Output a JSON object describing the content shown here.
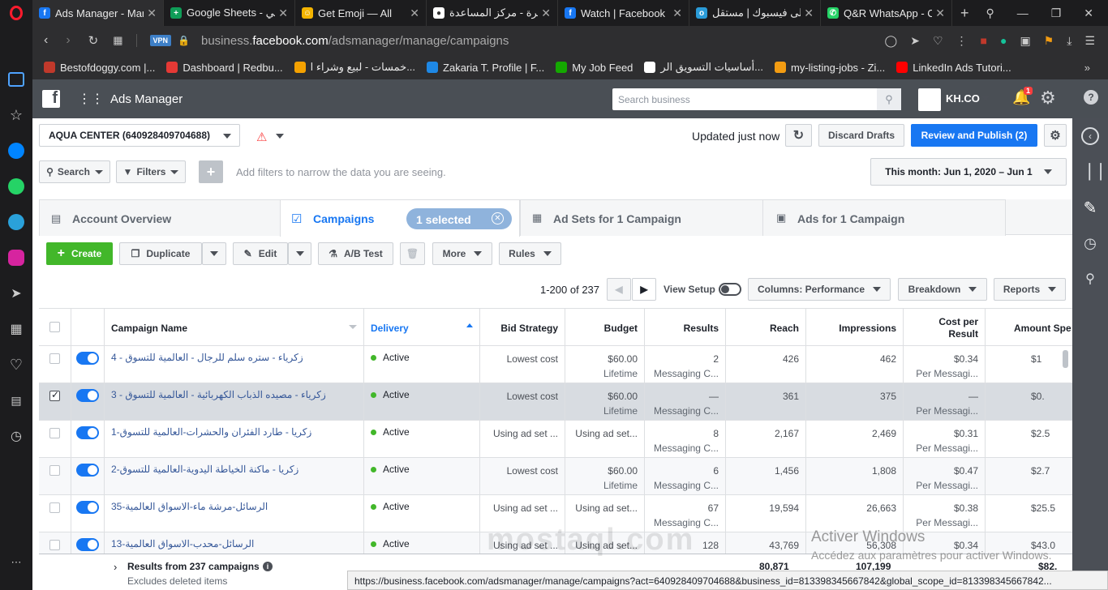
{
  "browser": {
    "tabs": [
      {
        "title": "Ads Manager - Man",
        "color": "#1877f2",
        "glyph": "f",
        "active": true
      },
      {
        "title": "Google Sheets - الي",
        "color": "#0f9d58",
        "glyph": "+"
      },
      {
        "title": "Get Emoji — All",
        "color": "#f4b400",
        "glyph": "☺"
      },
      {
        "title": "ذكرة - مركز المساعدة",
        "color": "#ffffff",
        "glyph": "●"
      },
      {
        "title": "Watch | Facebook",
        "color": "#1877f2",
        "glyph": "f"
      },
      {
        "title": "لى فيسبوك | مستقل",
        "color": "#2a9bd8",
        "glyph": "o"
      },
      {
        "title": "Q&R WhatsApp - C",
        "color": "#25d366",
        "glyph": "✆"
      }
    ],
    "url_prefix": "business.",
    "url_domain": "facebook.com",
    "url_path": "/adsmanager/manage/campaigns",
    "vpn_label": "VPN",
    "bookmarks": [
      {
        "label": "Bestofdoggy.com |...",
        "color": "#c0392b"
      },
      {
        "label": "Dashboard | Redbu...",
        "color": "#e53935"
      },
      {
        "label": "خمسات - لبيع وشراء ا...",
        "color": "#f4a100"
      },
      {
        "label": "Zakaria T. Profile | F...",
        "color": "#1e88e5"
      },
      {
        "label": "My Job Feed",
        "color": "#14a800"
      },
      {
        "label": "أساسيات التسويق الر...",
        "color": "#ffffff"
      },
      {
        "label": "my-listing-jobs - Zi...",
        "color": "#f39c12"
      },
      {
        "label": "LinkedIn Ads Tutori...",
        "color": "#ff0000"
      }
    ]
  },
  "header": {
    "app_name": "Ads Manager",
    "search_placeholder": "Search business",
    "account_short": "KH.CO",
    "notif_count": "1"
  },
  "toolbar": {
    "account_name": "AQUA CENTER (640928409704688)",
    "updated_text": "Updated just now",
    "discard_label": "Discard Drafts",
    "review_label": "Review and Publish (2)",
    "search_label": "Search",
    "filters_label": "Filters",
    "filter_placeholder": "Add filters to narrow the data you are seeing.",
    "date_range": "This month: Jun 1, 2020 – Jun 1"
  },
  "tabs": {
    "overview": "Account Overview",
    "campaigns": "Campaigns",
    "selected": "1 selected",
    "adsets": "Ad Sets for 1 Campaign",
    "ads": "Ads for 1 Campaign"
  },
  "actions": {
    "create": "Create",
    "duplicate": "Duplicate",
    "edit": "Edit",
    "abtest": "A/B Test",
    "more": "More",
    "rules": "Rules",
    "pagination": "1-200 of 237",
    "view_setup": "View Setup",
    "columns": "Columns: Performance",
    "breakdown": "Breakdown",
    "reports": "Reports"
  },
  "table": {
    "headers": {
      "name": "Campaign Name",
      "delivery": "Delivery",
      "bid": "Bid Strategy",
      "budget": "Budget",
      "results": "Results",
      "reach": "Reach",
      "impressions": "Impressions",
      "cpr1": "Cost per",
      "cpr2": "Result",
      "spent": "Amount Spe"
    },
    "rows": [
      {
        "name": "4 - زكرياء - ستره سلم للرجال - العالمية للتسوق",
        "delivery": "Active",
        "bid": "Lowest cost",
        "budget": "$60.00",
        "budget_sub": "Lifetime",
        "results": "2",
        "results_sub": "Messaging C...",
        "reach": "426",
        "impressions": "462",
        "cpr": "$0.34",
        "cpr_sub": "Per Messagi...",
        "spent": "$1",
        "checked": false
      },
      {
        "name": "3 - زكرياء - مصيده الذباب الكهربائية - العالمية للتسوق",
        "delivery": "Active",
        "bid": "Lowest cost",
        "budget": "$60.00",
        "budget_sub": "Lifetime",
        "results": "—",
        "results_sub": "Messaging C...",
        "reach": "361",
        "impressions": "375",
        "cpr": "—",
        "cpr_sub": "Per Messagi...",
        "spent": "$0.",
        "checked": true
      },
      {
        "name": "1-زكريا - طارد الفئران والحشرات-العالمية للتسوق",
        "delivery": "Active",
        "bid": "Using ad set ...",
        "budget": "Using ad set...",
        "budget_sub": "",
        "results": "8",
        "results_sub": "Messaging C...",
        "reach": "2,167",
        "impressions": "2,469",
        "cpr": "$0.31",
        "cpr_sub": "Per Messagi...",
        "spent": "$2.5",
        "checked": false
      },
      {
        "name": "2-زكريا - ماكنة الخياطة اليدوية-العالمية للتسوق",
        "delivery": "Active",
        "bid": "Lowest cost",
        "budget": "$60.00",
        "budget_sub": "Lifetime",
        "results": "6",
        "results_sub": "Messaging C...",
        "reach": "1,456",
        "impressions": "1,808",
        "cpr": "$0.47",
        "cpr_sub": "Per Messagi...",
        "spent": "$2.7",
        "checked": false
      },
      {
        "name": "35-الرسائل-مرشة ماء-الاسواق العالمية",
        "delivery": "Active",
        "bid": "Using ad set ...",
        "budget": "Using ad set...",
        "budget_sub": "",
        "results": "67",
        "results_sub": "Messaging C...",
        "reach": "19,594",
        "impressions": "26,663",
        "cpr": "$0.38",
        "cpr_sub": "Per Messagi...",
        "spent": "$25.5",
        "checked": false
      },
      {
        "name": "13-الرسائل-محدب-الاسواق العالمية",
        "delivery": "Active",
        "bid": "Using ad set ...",
        "budget": "Using ad set...",
        "budget_sub": "",
        "results": "128",
        "results_sub": "",
        "reach": "43,769",
        "impressions": "56,308",
        "cpr": "$0.34",
        "cpr_sub": "",
        "spent": "$43.0",
        "checked": false
      }
    ],
    "footer_title": "Results from 237 campaigns",
    "footer_sub": "Excludes deleted items",
    "footer_reach": "80,871",
    "footer_impr": "107,199",
    "footer_spent": "$82."
  },
  "overlay": {
    "watermark": "mostaql.com",
    "activate_title": "Activer Windows",
    "activate_sub": "Accédez aux paramètres pour activer Windows.",
    "status_url": "https://business.facebook.com/adsmanager/manage/campaigns?act=640928409704688&business_id=813398345667842&global_scope_id=813398345667842..."
  }
}
